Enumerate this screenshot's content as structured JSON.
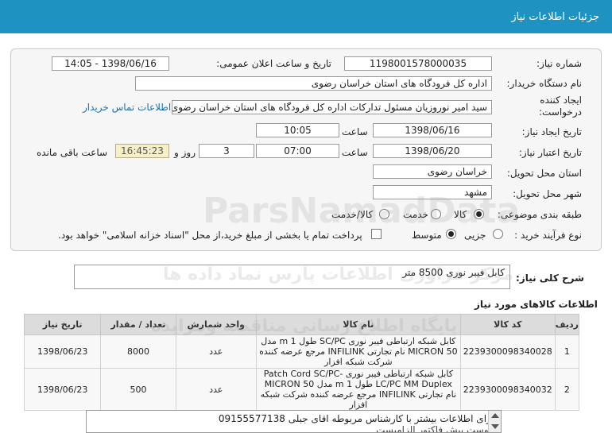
{
  "header": {
    "title": "جزئیات اطلاعات نیاز"
  },
  "form": {
    "need_number_label": "شماره نیاز:",
    "need_number": "1198001578000035",
    "announce_label": "تاریخ و ساعت اعلان عمومی:",
    "announce_value": "1398/06/16 - 14:05",
    "buyer_org_label": "نام دستگاه خریدار:",
    "buyer_org": "اداره کل فرودگاه های استان خراسان رضوی",
    "creator_label_1": "ایجاد کننده",
    "creator_label_2": "درخواست:",
    "creator": "سید امیر نوروزیان مسئول تدارکات اداره کل فرودگاه های استان خراسان رضوی",
    "contact_link": "اطلاعات تماس خریدار",
    "created_date_label": "تاریخ ایجاد نیاز:",
    "created_date": "1398/06/16",
    "time_label": "ساعت",
    "created_time": "10:05",
    "valid_date_label": "تاریخ اعتبار نیاز:",
    "valid_date": "1398/06/20",
    "valid_time": "07:00",
    "days": "3",
    "days_label": "روز و",
    "remaining_time": "16:45:23",
    "remaining_label": "ساعت باقی مانده",
    "province_label": "استان محل تحویل:",
    "province": "خراسان رضوی",
    "city_label": "شهر محل تحویل:",
    "city": "مشهد",
    "category_label": "طبقه بندی موضوعی:",
    "category_options": [
      "کالا",
      "خدمت",
      "کالا/خدمت"
    ],
    "process_label": "نوع فرآیند خرید :",
    "process_options": [
      "جزیی",
      "متوسط"
    ],
    "payment_note": "پرداخت تمام یا بخشی از مبلغ خرید،از محل \"اسناد خزانه اسلامی\" خواهد بود."
  },
  "description": {
    "label": "شرح کلی نیاز:",
    "value": "کابل فیبر نوری 8500 متر"
  },
  "items_section": {
    "title": "اطلاعات کالاهای مورد نیاز",
    "columns": [
      "ردیف",
      "کد کالا",
      "نام کالا",
      "واحد شمارش",
      "تعداد / مقدار",
      "تاریخ نیاز"
    ],
    "rows": [
      {
        "row": "1",
        "code": "2239300098340028",
        "name": "کابل شبکه ارتباطی فیبر نوری SC/PC طول 1 m مدل MICRON 50 نام تجارتی INFILINK مرجع عرضه کننده شرکت شبکه افزار",
        "unit": "عدد",
        "qty": "8000",
        "date": "1398/06/23"
      },
      {
        "row": "2",
        "code": "2239300098340032",
        "name": "کابل شبکه ارتباطی فیبر نوری Patch Cord SC/PC-LC/PC MM Duplex طول 1 m مدل MICRON 50 نام تجارتی INFILINK مرجع عرضه کننده شرکت شبکه افزار",
        "unit": "عدد",
        "qty": "500",
        "date": "1398/06/23"
      }
    ]
  },
  "notes": {
    "line1": "برای اطلاعات بیشتر با کارشناس مربوطه اقای جبلی 09155577138",
    "line2": "پیوست پیش فاکتور الزامیست"
  },
  "watermarks": {
    "w1": "ParsNamadData",
    "w2": "مرکز فراوری اطلاعات پارس نماد داده ها",
    "w3": "پایگاه اطلاع رسانی مناقصه ومزایده"
  }
}
